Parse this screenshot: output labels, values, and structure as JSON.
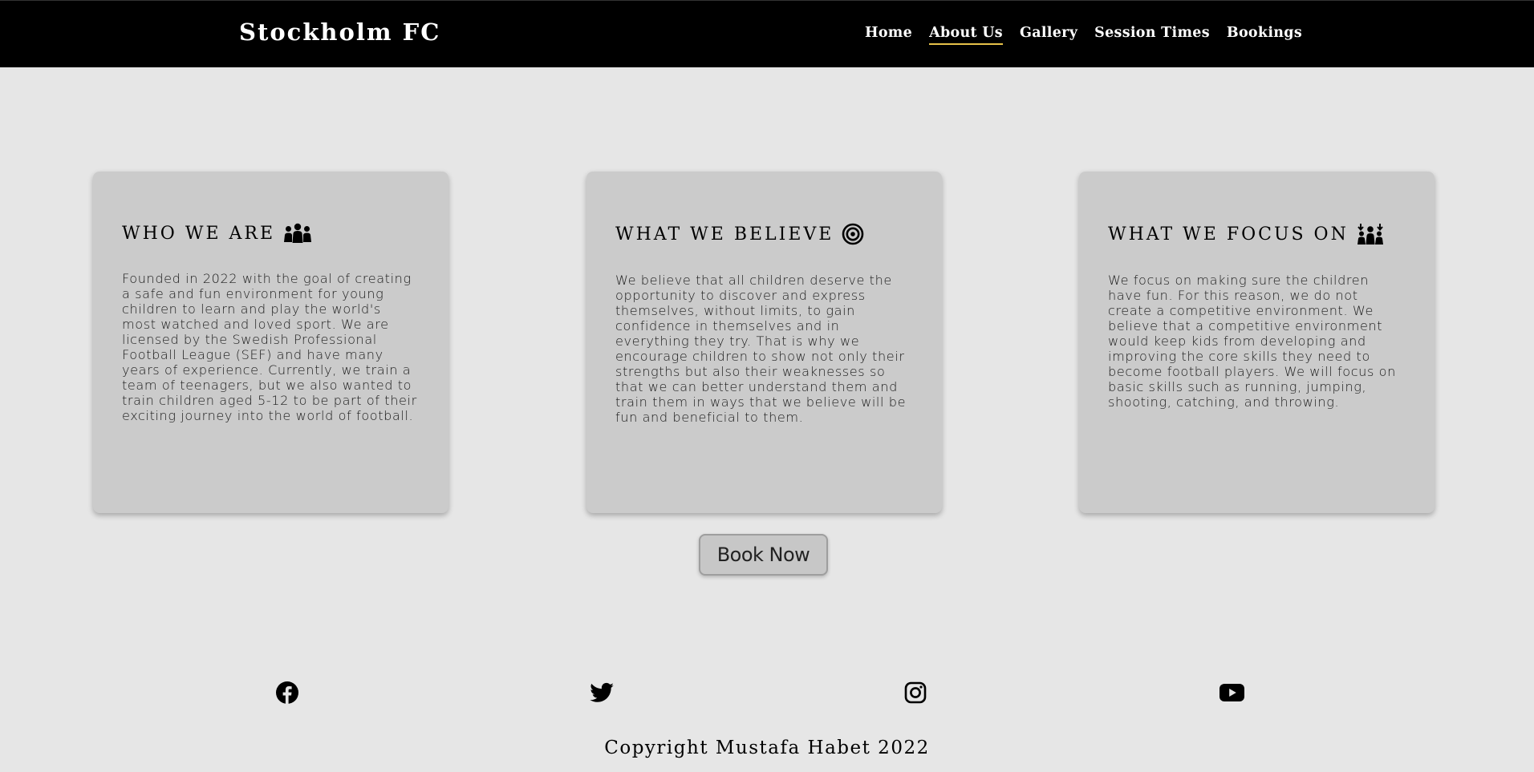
{
  "header": {
    "brand": "Stockholm FC",
    "nav": [
      {
        "label": "Home",
        "active": false
      },
      {
        "label": "About Us",
        "active": true
      },
      {
        "label": "Gallery",
        "active": false
      },
      {
        "label": "Session Times",
        "active": false
      },
      {
        "label": "Bookings",
        "active": false
      }
    ],
    "accent_color": "#e6c24a"
  },
  "cards": [
    {
      "title": "WHO WE ARE",
      "icon": "people-group-icon",
      "text": "Founded in 2022 with the goal of creating a safe and fun environment for young children to learn and play the world's most watched and loved sport. We are licensed by the Swedish Professional Football League (SEF) and have many years of experience. Currently, we train a team of teenagers, but we also wanted to train children aged 5-12 to be part of their exciting journey into the world of football."
    },
    {
      "title": "WHAT WE BELIEVE",
      "icon": "bullseye-icon",
      "text": "We believe that all children deserve the opportunity to discover and express themselves, without limits, to gain confidence in themselves and in everything they try. That is why we encourage children to show not only their strengths but also their weaknesses so that we can better understand them and train them in ways that we believe will be fun and beneficial to them."
    },
    {
      "title": "WHAT WE FOCUS ON",
      "icon": "people-arrows-down-icon",
      "text": "We focus on making sure the children have fun. For this reason, we do not create a competitive environment. We believe that a competitive environment would keep kids from developing and improving the core skills they need to become football players. We will focus on basic skills such as running, jumping, shooting, catching, and throwing."
    }
  ],
  "cta": {
    "label": "Book Now"
  },
  "footer": {
    "social": [
      "facebook-icon",
      "twitter-icon",
      "instagram-icon",
      "youtube-icon"
    ],
    "copyright": "Copyright Mustafa Habet 2022"
  },
  "colors": {
    "page_background": "#e6e6e6",
    "card_background": "#cbcbcb",
    "header_background": "#000000"
  }
}
